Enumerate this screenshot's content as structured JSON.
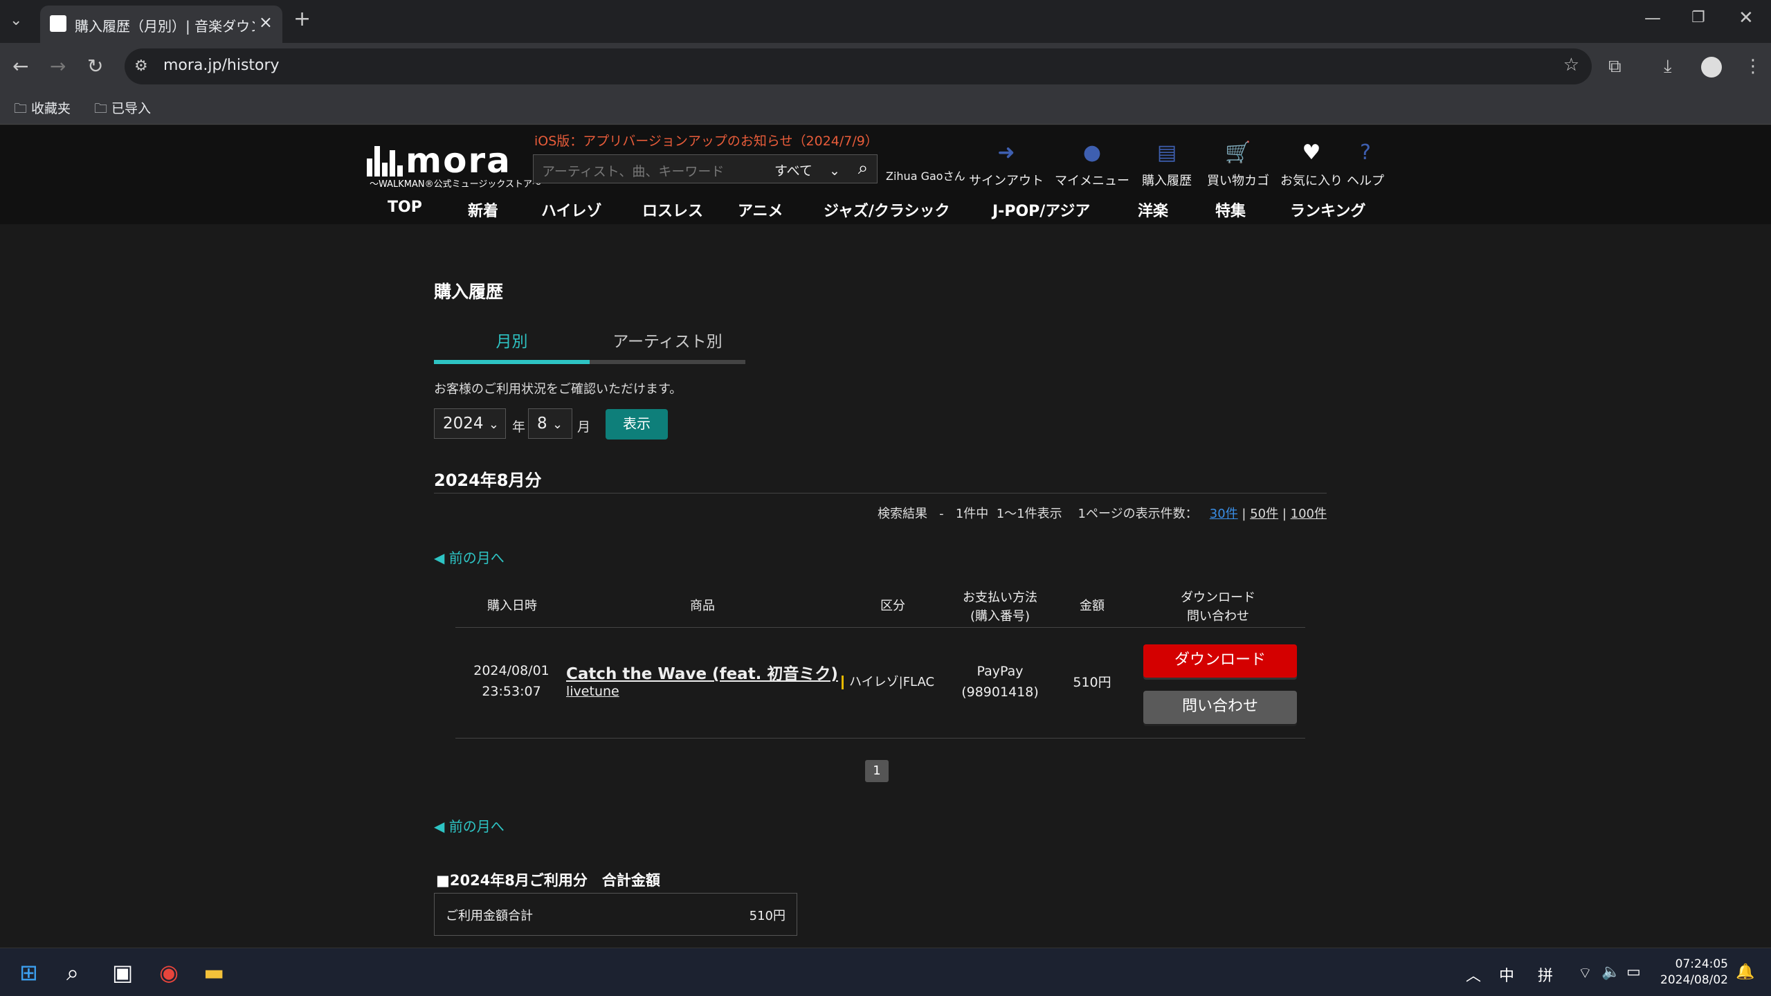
{
  "browser": {
    "tab_title": "購入履歴（月別）| 音楽ダウン",
    "url": "mora.jp/history",
    "bookmarks": [
      "收藏夹",
      "已导入"
    ]
  },
  "site": {
    "logo_text": "mora",
    "logo_sub": "〜WALKMAN®公式ミュージックストア〜",
    "notice": "iOS版：アプリバージョンアップのお知らせ（2024/7/9）",
    "search_placeholder": "アーティスト、曲、キーワード",
    "search_scope": "すべて",
    "user_name": "Zihua Gaoさん",
    "header_nav": [
      {
        "label": "サインアウト",
        "icon": "signout-icon"
      },
      {
        "label": "マイメニュー",
        "icon": "person-icon"
      },
      {
        "label": "購入履歴",
        "icon": "document-icon"
      },
      {
        "label": "買い物カゴ",
        "icon": "cart-icon"
      },
      {
        "label": "お気に入り",
        "icon": "heart-icon"
      },
      {
        "label": "ヘルプ",
        "icon": "help-icon"
      }
    ],
    "main_nav": [
      "TOP",
      "新着",
      "ハイレゾ",
      "ロスレス",
      "アニメ",
      "ジャズ/クラシック",
      "J-POP/アジア",
      "洋楽",
      "特集",
      "ランキング"
    ]
  },
  "history": {
    "title": "購入履歴",
    "tabs": [
      "月別",
      "アーティスト別"
    ],
    "note": "お客様のご利用状況をご確認いただけます。",
    "year": "2024",
    "year_unit": "年",
    "month": "8",
    "month_unit": "月",
    "show_button": "表示",
    "month_heading": "2024年8月分",
    "result_label": "検索結果",
    "result_dash": "-",
    "result_count": "1件中",
    "result_range": "1〜1件表示",
    "per_page_label": "1ページの表示件数：",
    "per_page_options": [
      "30件",
      "50件",
      "100件"
    ],
    "prev_month": "前の月へ",
    "columns": [
      "購入日時",
      "商品",
      "区分",
      "お支払い方法\n(購入番号)",
      "金額",
      "ダウンロード\n問い合わせ"
    ],
    "rows": [
      {
        "date": "2024/08/01",
        "time": "23:53:07",
        "title": "Catch the Wave (feat. 初音ミク)",
        "artist": "livetune",
        "category": "ハイレゾ|FLAC",
        "payment": "PayPay",
        "order_no": "(98901418)",
        "amount": "510円",
        "download_label": "ダウンロード",
        "inquiry_label": "問い合わせ"
      }
    ],
    "page": "1",
    "total_heading": "■2024年8月ご利用分　合計金額",
    "total_label": "ご利用金額合計",
    "total_value": "510円"
  },
  "taskbar": {
    "ime": [
      "中",
      "拼"
    ],
    "time": "07:24:05",
    "date": "2024/08/02"
  },
  "colors": {
    "accent": "#2ec4c4",
    "download": "#d40000",
    "show_button": "#0e7f7a",
    "notice": "#e85c3a"
  }
}
